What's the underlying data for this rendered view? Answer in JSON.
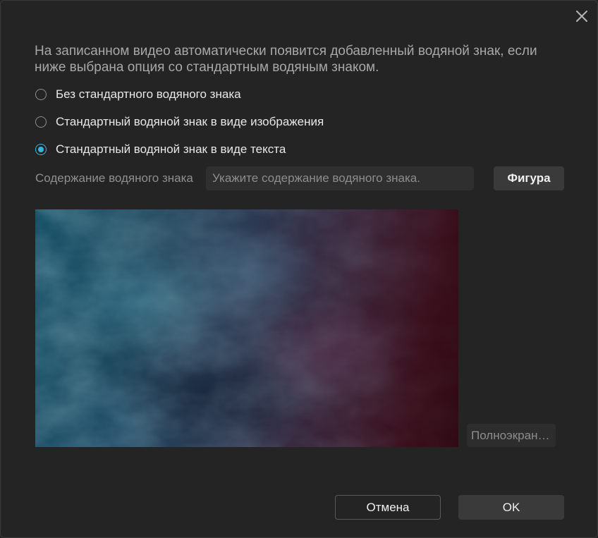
{
  "dialog": {
    "close_icon": "close-icon",
    "description": "На записанном видео автоматически появится добавленный водяной знак, если ниже выбрана опция со стандартным водяным знаком."
  },
  "options": [
    {
      "label": "Без стандартного водяного знака",
      "checked": false
    },
    {
      "label": "Стандартный водяной знак в виде изображения",
      "checked": false
    },
    {
      "label": "Стандартный водяной знак в виде текста",
      "checked": true
    }
  ],
  "watermark": {
    "label": "Содержание водяного знака",
    "value": "",
    "placeholder": "Укажите содержание водяного знака.",
    "figure_label": "Фигура"
  },
  "preview": {
    "fullscreen_label": "Полноэкран…"
  },
  "footer": {
    "cancel_label": "Отмена",
    "ok_label": "OK"
  },
  "colors": {
    "accent": "#3bb3e0",
    "background": "#242424"
  }
}
